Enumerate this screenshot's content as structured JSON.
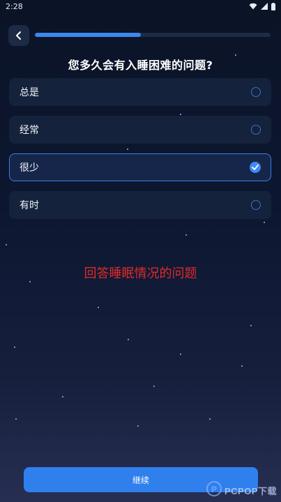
{
  "status_bar": {
    "time": "2:28",
    "icons": [
      "wifi-icon",
      "signal-icon",
      "battery-icon"
    ]
  },
  "header": {
    "back_icon": "chevron-left-icon",
    "progress": 0.45
  },
  "question": "您多久会有入睡困难的问题?",
  "options": [
    {
      "label": "总是",
      "selected": false
    },
    {
      "label": "经常",
      "selected": false
    },
    {
      "label": "很少",
      "selected": true
    },
    {
      "label": "有时",
      "selected": false
    }
  ],
  "caption": "回答睡眠情况的问题",
  "continue_label": "继续",
  "watermark": "PCPOP下载",
  "colors": {
    "accent": "#2f80ed",
    "caption": "#e22a2a",
    "card": "#15223c"
  }
}
